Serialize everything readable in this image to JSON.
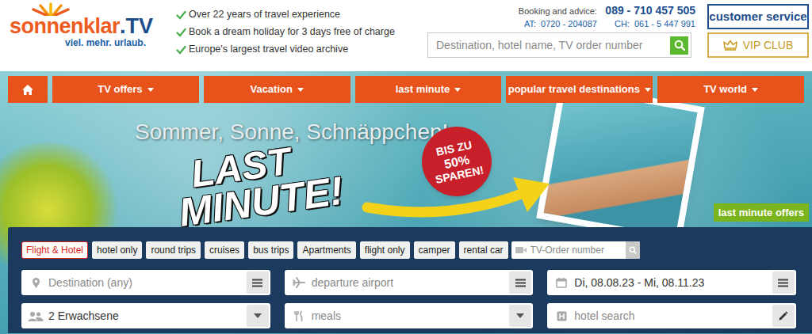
{
  "logo": {
    "brand": "sonnenklar",
    "suffix": ".TV",
    "tagline": "viel. mehr. urlaub."
  },
  "usps": [
    "Over 22 years of travel experience",
    "Book a dream holiday for 3 days free of charge",
    "Europe's largest travel video archive"
  ],
  "contact": {
    "label": "Booking and advice:",
    "phone": "089 - 710 457 505",
    "secondary": [
      {
        "country": "AT:",
        "phone": "0720 - 204087"
      },
      {
        "country": "CH:",
        "phone": "061 - 5 447 991"
      }
    ]
  },
  "site_search": {
    "placeholder": "Destination, hotel name, TV order number"
  },
  "customer_service": "customer service",
  "vip_club": "VIP CLUB",
  "nav": [
    {
      "label": "TV offers"
    },
    {
      "label": "Vacation"
    },
    {
      "label": "last minute"
    },
    {
      "label": "popular travel destinations"
    },
    {
      "label": "TV world"
    }
  ],
  "banner": {
    "headline": "Sommer, Sonne, Schnäppchen!",
    "title": [
      "LAST",
      "MINUTE!"
    ],
    "badge": [
      "BIS ZU",
      "50%",
      "SPAREN!"
    ],
    "link": "last minute offers"
  },
  "search": {
    "tabs": [
      {
        "label": "Flight & Hotel",
        "selected": true
      },
      {
        "label": "hotel only",
        "selected": false
      },
      {
        "label": "round trips",
        "selected": false
      },
      {
        "label": "cruises",
        "selected": false
      },
      {
        "label": "bus trips",
        "selected": false
      },
      {
        "label": "Apartments",
        "selected": false
      },
      {
        "label": "flight only",
        "selected": false
      },
      {
        "label": "camper",
        "selected": false
      },
      {
        "label": "rental car",
        "selected": false
      }
    ],
    "order_number": {
      "placeholder": "TV-Order number"
    },
    "fields": [
      {
        "kind": "destination",
        "text": "Destination (any)",
        "filled": false
      },
      {
        "kind": "airport",
        "text": "departure airport",
        "filled": false
      },
      {
        "kind": "dates",
        "text": "Di, 08.08.23 - Mi, 08.11.23",
        "filled": true
      },
      {
        "kind": "travellers",
        "text": "2 Erwachsene",
        "filled": true
      },
      {
        "kind": "meals",
        "text": "meals",
        "filled": false
      },
      {
        "kind": "hotel",
        "text": "hotel search",
        "filled": false
      }
    ]
  }
}
